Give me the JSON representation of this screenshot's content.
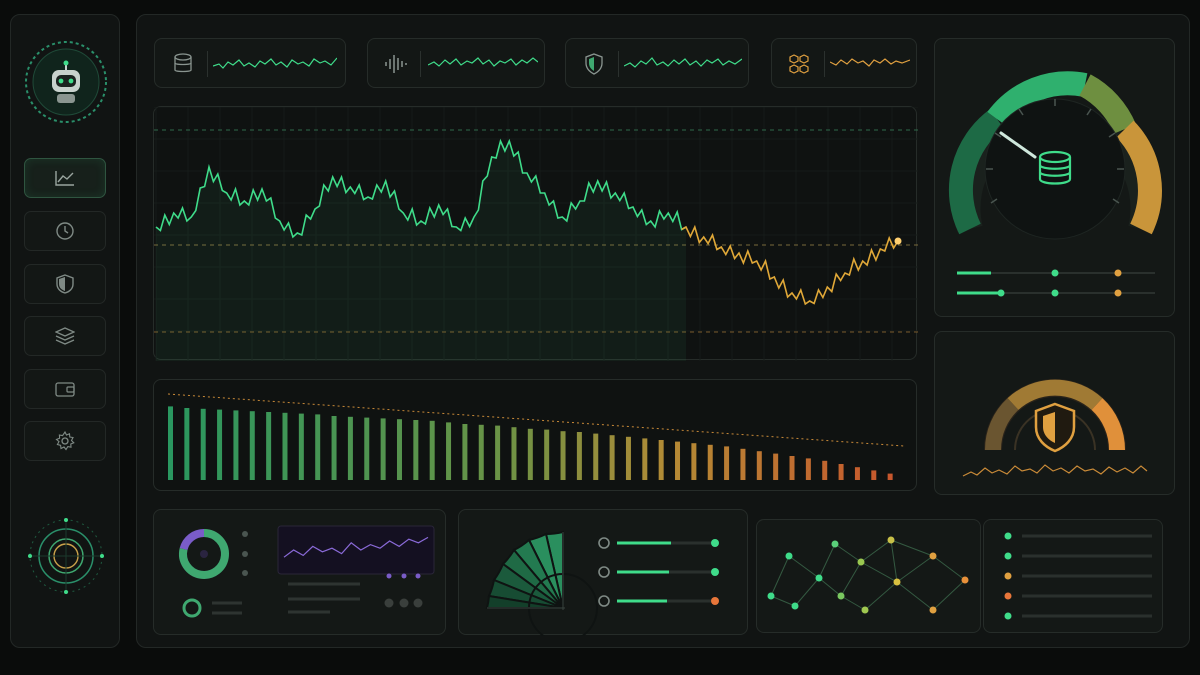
{
  "sidebar": {
    "avatar_icon": "robot-icon",
    "items": [
      {
        "icon": "line-chart-icon",
        "active": true
      },
      {
        "icon": "clock-icon",
        "active": false
      },
      {
        "icon": "shield-icon",
        "active": false
      },
      {
        "icon": "layers-icon",
        "active": false
      },
      {
        "icon": "wallet-icon",
        "active": false
      },
      {
        "icon": "gear-icon",
        "active": false
      }
    ],
    "bottom_icon": "radar-icon"
  },
  "metric_chips": [
    {
      "icon": "database-icon",
      "color": "#3fdc8a"
    },
    {
      "icon": "waveform-icon",
      "color": "#3fdc8a"
    },
    {
      "icon": "shield-icon",
      "color": "#3fdc8a"
    },
    {
      "icon": "hexagon-cluster-icon",
      "color": "#e0a040"
    }
  ],
  "colors": {
    "accent_green": "#3fdc8a",
    "accent_amber": "#e0a040",
    "accent_orange": "#e8763a",
    "accent_purple": "#7a5cc8",
    "background": "#0a0c0b"
  },
  "gauges": {
    "database_gauge": {
      "icon": "database-icon",
      "level": 0.25
    },
    "security_gauge": {
      "icon": "shield-icon",
      "level": 0.7
    }
  },
  "chart_data": [
    {
      "type": "line",
      "series": [
        {
          "values": [
            0.55,
            0.62,
            0.6,
            0.85,
            0.72,
            0.68,
            0.74,
            0.58,
            0.52,
            0.64,
            0.8,
            0.75,
            0.7,
            0.78,
            0.62,
            0.58,
            0.66,
            0.55,
            0.6,
            0.9,
            0.98,
            0.82,
            0.72,
            0.6,
            0.68,
            0.78,
            0.72,
            0.65,
            0.58,
            0.62,
            0.55,
            0.5,
            0.45,
            0.42,
            0.38,
            0.3,
            0.22,
            0.18,
            0.25,
            0.32,
            0.38,
            0.44,
            0.48
          ]
        }
      ],
      "reference_lines": 3,
      "grid": true
    },
    {
      "type": "bar",
      "values": [
        0.92,
        0.9,
        0.89,
        0.88,
        0.87,
        0.86,
        0.85,
        0.84,
        0.83,
        0.82,
        0.8,
        0.79,
        0.78,
        0.77,
        0.76,
        0.75,
        0.74,
        0.72,
        0.7,
        0.69,
        0.68,
        0.66,
        0.64,
        0.63,
        0.61,
        0.6,
        0.58,
        0.56,
        0.54,
        0.52,
        0.5,
        0.48,
        0.46,
        0.44,
        0.42,
        0.39,
        0.36,
        0.33,
        0.3,
        0.27,
        0.24,
        0.2,
        0.16,
        0.12,
        0.08
      ],
      "trend_line": true
    },
    {
      "type": "pie",
      "values": [
        0.7,
        0.3
      ]
    },
    {
      "type": "line",
      "series": [
        {
          "values": [
            0.3,
            0.5,
            0.35,
            0.6,
            0.45,
            0.55,
            0.4,
            0.7,
            0.5,
            0.65,
            0.55,
            0.75,
            0.6,
            0.8,
            0.7,
            0.85
          ]
        }
      ]
    }
  ],
  "node_graph": {
    "nodes": 15,
    "legend_dots": [
      "#3fdc8a",
      "#3fdc8a",
      "#e0a040",
      "#e8763a",
      "#3fdc8a"
    ]
  }
}
